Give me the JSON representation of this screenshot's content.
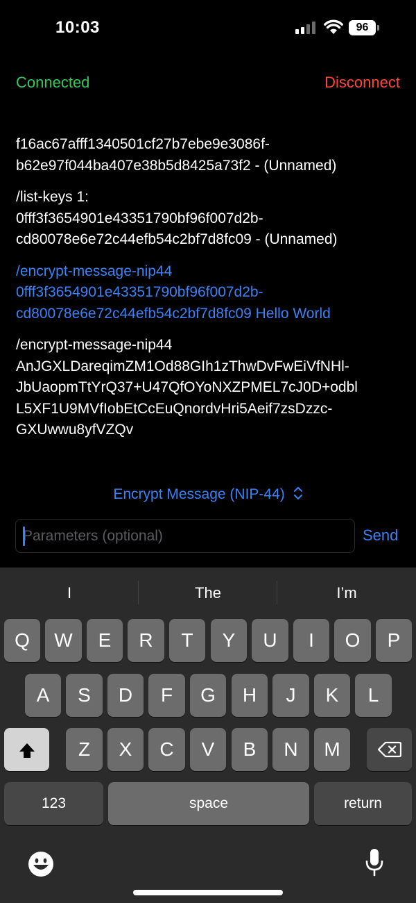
{
  "status_bar": {
    "time": "10:03",
    "battery": "96",
    "signal_icon": "cellular-signal-icon",
    "wifi_icon": "wifi-icon"
  },
  "header": {
    "connection_status": "Connected",
    "disconnect_label": "Disconnect",
    "status_color": "#34c759",
    "disconnect_color": "#ff453a"
  },
  "log": {
    "entries": [
      {
        "text": "f16ac67afff1340501cf27b7ebe9e3086f-\nb62e97f044ba407e38b5d8425a73f2 - (Unnamed)",
        "kind": "response"
      },
      {
        "text": "/list-keys 1:\n0fff3f3654901e43351790bf96f007d2b-\ncd80078e6e72c44efb54c2bf7d8fc09 - (Unnamed)",
        "kind": "response"
      },
      {
        "text": "/encrypt-message-nip44\n0fff3f3654901e43351790bf96f007d2b-\ncd80078e6e72c44efb54c2bf7d8fc09 Hello World",
        "kind": "command"
      },
      {
        "text": "/encrypt-message-nip44\nAnJGXLDareqimZM1Od88GIh1zThwDvFwEiVfNHl-\nJbUaopmTtYrQ37+U47QfOYoNXZPMEL7cJ0D+odbl\nL5XF1U9MVfIobEtCcEuQnordvHri5Aeif7zsDzzc-\nGXUwwu8yfVZQv",
        "kind": "response"
      }
    ],
    "command_color": "#3a82f7"
  },
  "command_picker": {
    "label": "Encrypt Message (NIP-44)",
    "icon": "chevron-up-down-icon"
  },
  "input": {
    "placeholder": "Parameters (optional)",
    "value": "",
    "send_label": "Send"
  },
  "keyboard": {
    "suggestions": [
      "I",
      "The",
      "I’m"
    ],
    "row1": [
      "Q",
      "W",
      "E",
      "R",
      "T",
      "Y",
      "U",
      "I",
      "O",
      "P"
    ],
    "row2": [
      "A",
      "S",
      "D",
      "F",
      "G",
      "H",
      "J",
      "K",
      "L"
    ],
    "row3": [
      "Z",
      "X",
      "C",
      "V",
      "B",
      "N",
      "M"
    ],
    "numbers_label": "123",
    "space_label": "space",
    "return_label": "return",
    "shift_icon": "shift-icon",
    "delete_icon": "delete-backspace-icon",
    "emoji_icon": "emoji-icon",
    "mic_icon": "microphone-icon"
  }
}
